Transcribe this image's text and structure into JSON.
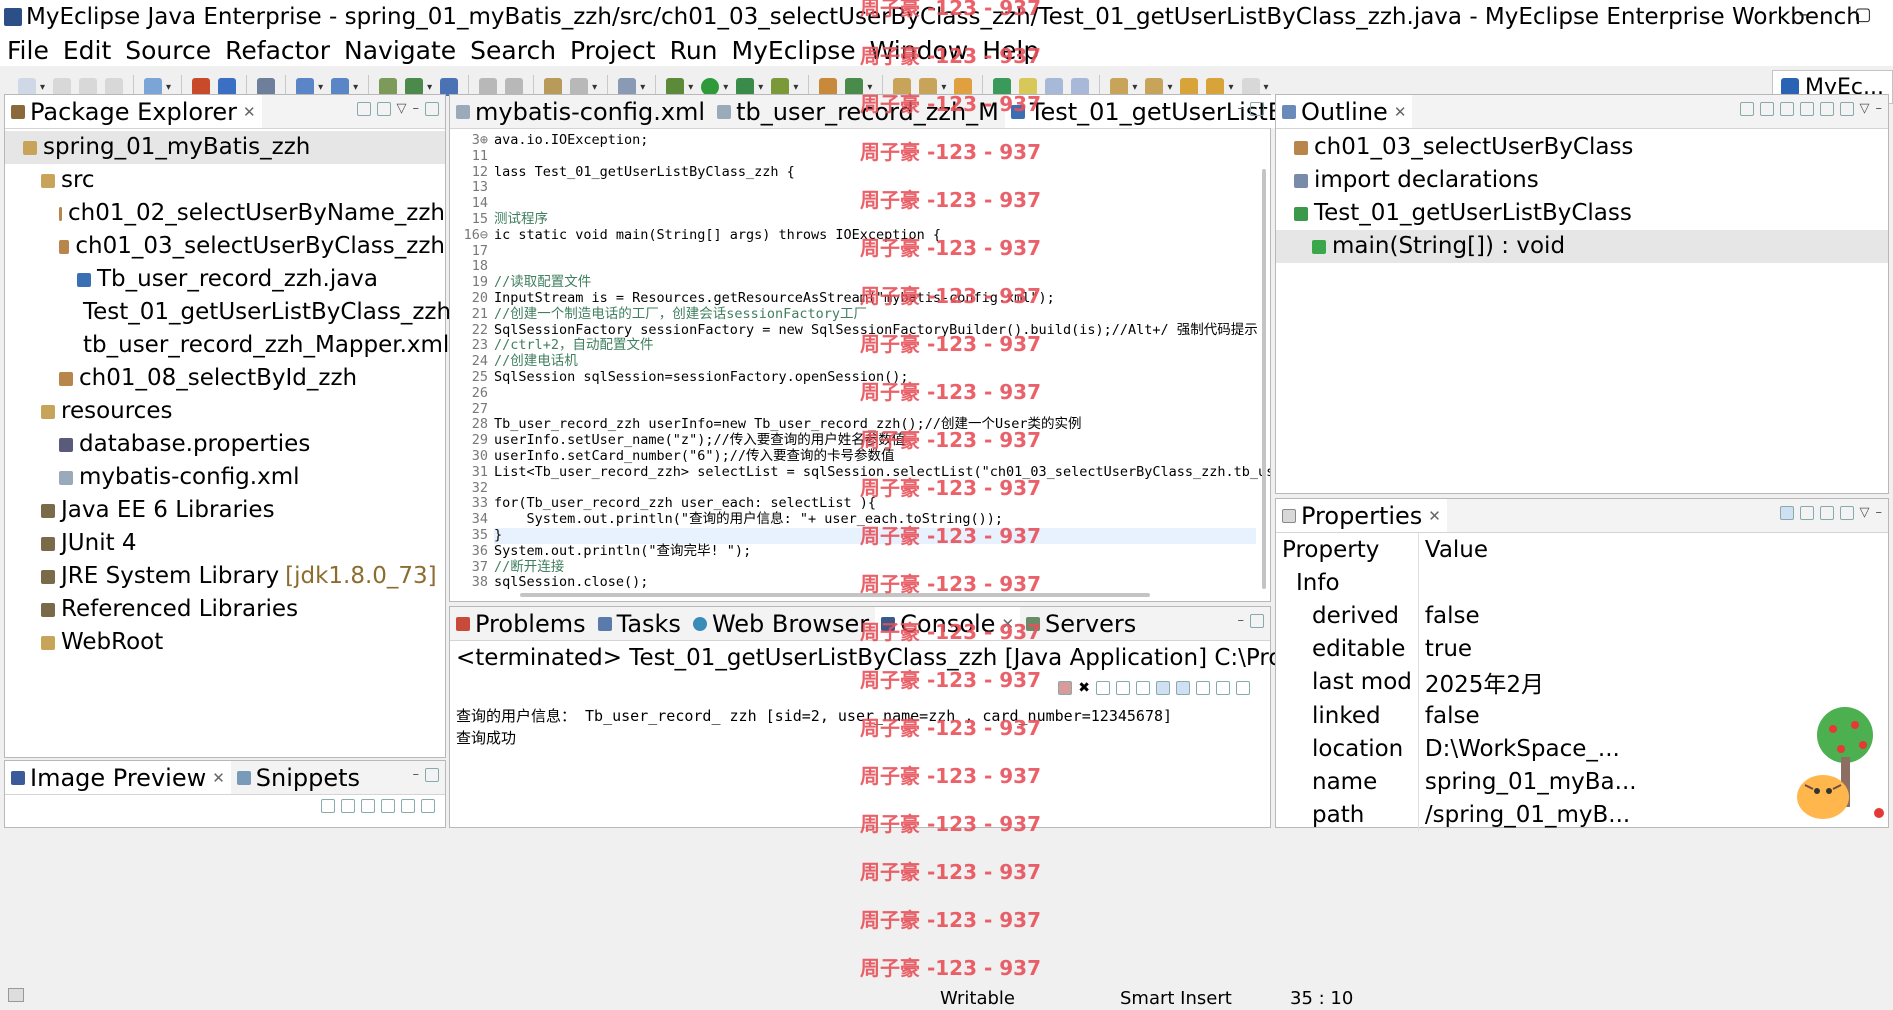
{
  "window": {
    "title": "MyEclipse Java Enterprise - spring_01_myBatis_zzh/src/ch01_03_selectUserByClass_zzh/Test_01_getUserListByClass_zzh.java - MyEclipse Enterprise Workbench",
    "minimize": "–",
    "maximize": "▢"
  },
  "menu": [
    "File",
    "Edit",
    "Source",
    "Refactor",
    "Navigate",
    "Search",
    "Project",
    "Run",
    "MyEclipse",
    "Window",
    "Help"
  ],
  "perspective_label": "MyEc...",
  "package_explorer": {
    "tab_label": "Package Explorer",
    "items": [
      {
        "label": "spring_01_myBatis_zzh",
        "indent": 0,
        "icon": "project-icon"
      },
      {
        "label": "src",
        "indent": 1,
        "icon": "source-folder-icon"
      },
      {
        "label": "ch01_02_selectUserByName_zzh",
        "indent": 2,
        "icon": "package-icon"
      },
      {
        "label": "ch01_03_selectUserByClass_zzh",
        "indent": 2,
        "icon": "package-icon"
      },
      {
        "label": "Tb_user_record_zzh.java",
        "indent": 3,
        "icon": "java-file-icon"
      },
      {
        "label": "Test_01_getUserListByClass_zzh.java",
        "indent": 3,
        "icon": "java-file-icon"
      },
      {
        "label": "tb_user_record_zzh_Mapper.xml",
        "indent": 3,
        "icon": "xml-file-icon"
      },
      {
        "label": "ch01_08_selectById_zzh",
        "indent": 2,
        "icon": "package-icon"
      },
      {
        "label": "resources",
        "indent": 1,
        "icon": "source-folder-icon"
      },
      {
        "label": "database.properties",
        "indent": 2,
        "icon": "properties-file-icon"
      },
      {
        "label": "mybatis-config.xml",
        "indent": 2,
        "icon": "xml-file-icon"
      },
      {
        "label": "Java EE 6 Libraries",
        "indent": 1,
        "icon": "library-icon"
      },
      {
        "label": "JUnit 4",
        "indent": 1,
        "icon": "library-icon"
      },
      {
        "label": "JRE System Library",
        "indent": 1,
        "icon": "library-icon",
        "suffix": "[jdk1.8.0_73]"
      },
      {
        "label": "Referenced Libraries",
        "indent": 1,
        "icon": "library-icon"
      },
      {
        "label": "WebRoot",
        "indent": 1,
        "icon": "folder-icon"
      }
    ]
  },
  "image_preview": {
    "tabs": [
      "Image Preview",
      "Snippets"
    ]
  },
  "editor": {
    "tabs": [
      "mybatis-config.xml",
      "tb_user_record_zzh_M",
      "Test_01_getUserListB"
    ],
    "overflow": "»2",
    "line_numbers": [
      "3⊕",
      "11",
      "12",
      "13",
      "14",
      "15",
      "16⊖",
      "17",
      "18",
      "19",
      "20",
      "21",
      "22",
      "23",
      "24",
      "25",
      "26",
      "27",
      "28",
      "29",
      "30",
      "31",
      "32",
      "33",
      "34",
      "35",
      "36",
      "37",
      "38"
    ],
    "lines": [
      "ava.io.IOException;",
      "",
      "lass Test_01_getUserListByClass_zzh {",
      "",
      "",
      "测试程序",
      "ic static void main(String[] args) throws IOException {",
      "",
      "",
      "//读取配置文件",
      "InputStream is = Resources.getResourceAsStream(\"mybatis-config.xml\");",
      "//创建一个制造电话的工厂，创建会话sessionFactory工厂",
      "SqlSessionFactory sessionFactory = new SqlSessionFactoryBuilder().build(is);//Alt+/ 强制代码提示",
      "//ctrl+2，自动配置文件",
      "//创建电话机",
      "SqlSession sqlSession=sessionFactory.openSession();",
      "",
      "",
      "Tb_user_record_zzh userInfo=new Tb_user_record_zzh();//创建一个User类的实例",
      "userInfo.setUser_name(\"z\");//传入要查询的用户姓名参数值",
      "userInfo.setCard_number(\"6\");//传入要查询的卡号参数值",
      "List<Tb_user_record_zzh> selectList = sqlSession.selectList(\"ch01_03_selectUserByClass_zzh.tb_user_rec",
      "",
      "for(Tb_user_record_zzh user_each: selectList ){",
      "    System.out.println(\"查询的用户信息: \"+ user_each.toString());",
      "}",
      "System.out.println(\"查询完毕! \");",
      "//断开连接",
      "sqlSession.close();"
    ]
  },
  "bottom_tabs": [
    "Problems",
    "Tasks",
    "Web Browser",
    "Console",
    "Servers"
  ],
  "console": {
    "title": "<terminated> Test_01_getUserListByClass_zzh [Java Application] C:\\Program Files (x86)\\Ja",
    "output": [
      "查询的用户信息： Tb_user_record_ zzh [sid=2, user_name=zzh , card_number=12345678]",
      "查询成功"
    ]
  },
  "outline": {
    "tab_label": "Outline",
    "items": [
      {
        "label": "ch01_03_selectUserByClass",
        "indent": 0,
        "icon": "package-icon"
      },
      {
        "label": "import declarations",
        "indent": 0,
        "icon": "import-icon"
      },
      {
        "label": "Test_01_getUserListByClass",
        "indent": 0,
        "icon": "class-icon"
      },
      {
        "label": "main(String[]) : void",
        "indent": 1,
        "icon": "method-icon"
      }
    ]
  },
  "properties": {
    "tab_label": "Properties",
    "header": [
      "Property",
      "Value"
    ],
    "group": "Info",
    "rows": [
      {
        "key": "derived",
        "value": "false"
      },
      {
        "key": "editable",
        "value": "true"
      },
      {
        "key": "last mod",
        "value": "2025年2月"
      },
      {
        "key": "linked",
        "value": "false"
      },
      {
        "key": "location",
        "value": "D:\\WorkSpace_..."
      },
      {
        "key": "name",
        "value": "spring_01_myBa..."
      },
      {
        "key": "path",
        "value": "/spring_01_myB..."
      }
    ]
  },
  "watermark_text": "周子豪 -123 - 937",
  "status": {
    "writable": "Writable",
    "insert_mode": "Smart Insert",
    "position": "35 : 10"
  }
}
